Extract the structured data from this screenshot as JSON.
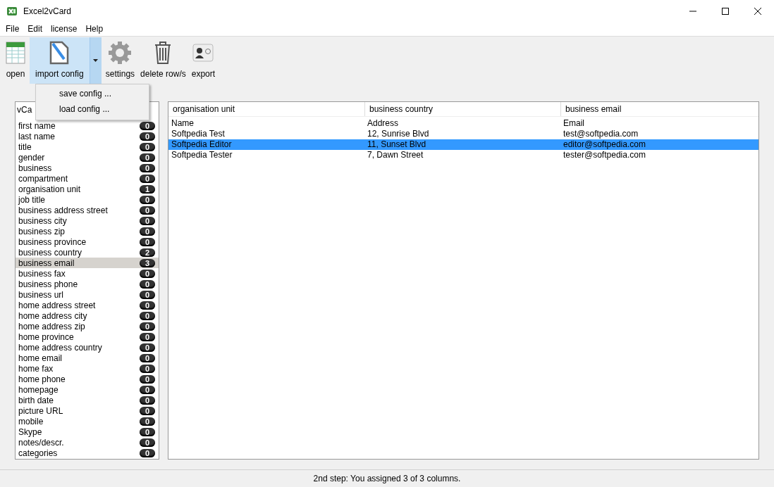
{
  "window": {
    "title": "Excel2vCard"
  },
  "menu": [
    "File",
    "Edit",
    "license",
    "Help"
  ],
  "toolbar": [
    {
      "label": "open",
      "kind": "open",
      "expanded": false
    },
    {
      "label": "import config",
      "kind": "import",
      "expanded": true
    },
    {
      "label": "settings",
      "kind": "settings",
      "expanded": false
    },
    {
      "label": "delete row/s",
      "kind": "delete",
      "expanded": false
    },
    {
      "label": "export",
      "kind": "export",
      "expanded": false
    }
  ],
  "dropdown_menu": [
    "save config ...",
    "load config ..."
  ],
  "fields": {
    "header": "vCa",
    "items": [
      {
        "label": "first name",
        "count": "0",
        "selected": false
      },
      {
        "label": "last name",
        "count": "0",
        "selected": false
      },
      {
        "label": "title",
        "count": "0",
        "selected": false
      },
      {
        "label": "gender",
        "count": "0",
        "selected": false
      },
      {
        "label": "business",
        "count": "0",
        "selected": false
      },
      {
        "label": "compartment",
        "count": "0",
        "selected": false
      },
      {
        "label": "organisation unit",
        "count": "1",
        "selected": false
      },
      {
        "label": "job title",
        "count": "0",
        "selected": false
      },
      {
        "label": "business address street",
        "count": "0",
        "selected": false
      },
      {
        "label": "business city",
        "count": "0",
        "selected": false
      },
      {
        "label": "business zip",
        "count": "0",
        "selected": false
      },
      {
        "label": "business province",
        "count": "0",
        "selected": false
      },
      {
        "label": "business country",
        "count": "2",
        "selected": false
      },
      {
        "label": "business email",
        "count": "3",
        "selected": true
      },
      {
        "label": "business fax",
        "count": "0",
        "selected": false
      },
      {
        "label": "business phone",
        "count": "0",
        "selected": false
      },
      {
        "label": "business url",
        "count": "0",
        "selected": false
      },
      {
        "label": "home address street",
        "count": "0",
        "selected": false
      },
      {
        "label": "home address city",
        "count": "0",
        "selected": false
      },
      {
        "label": "home address zip",
        "count": "0",
        "selected": false
      },
      {
        "label": "home province",
        "count": "0",
        "selected": false
      },
      {
        "label": "home address country",
        "count": "0",
        "selected": false
      },
      {
        "label": "home email",
        "count": "0",
        "selected": false
      },
      {
        "label": "home fax",
        "count": "0",
        "selected": false
      },
      {
        "label": "home phone",
        "count": "0",
        "selected": false
      },
      {
        "label": "homepage",
        "count": "0",
        "selected": false
      },
      {
        "label": "birth date",
        "count": "0",
        "selected": false
      },
      {
        "label": "picture URL",
        "count": "0",
        "selected": false
      },
      {
        "label": "mobile",
        "count": "0",
        "selected": false
      },
      {
        "label": "Skype",
        "count": "0",
        "selected": false
      },
      {
        "label": "notes/descr.",
        "count": "0",
        "selected": false
      },
      {
        "label": "categories",
        "count": "0",
        "selected": false
      }
    ]
  },
  "table": {
    "columns": [
      "organisation unit",
      "business country",
      "business email"
    ],
    "rows": [
      {
        "cells": [
          "Name",
          "Address",
          "Email"
        ],
        "selected": false
      },
      {
        "cells": [
          "Softpedia Test",
          "12, Sunrise Blvd",
          "test@softpedia.com"
        ],
        "selected": false
      },
      {
        "cells": [
          "Softpedia Editor",
          "11, Sunset Blvd",
          "editor@softpedia.com"
        ],
        "selected": true
      },
      {
        "cells": [
          "Softpedia Tester",
          "7, Dawn Street",
          "tester@softpedia.com"
        ],
        "selected": false
      }
    ]
  },
  "status_bar": "2nd step: You assigned 3 of 3 columns."
}
